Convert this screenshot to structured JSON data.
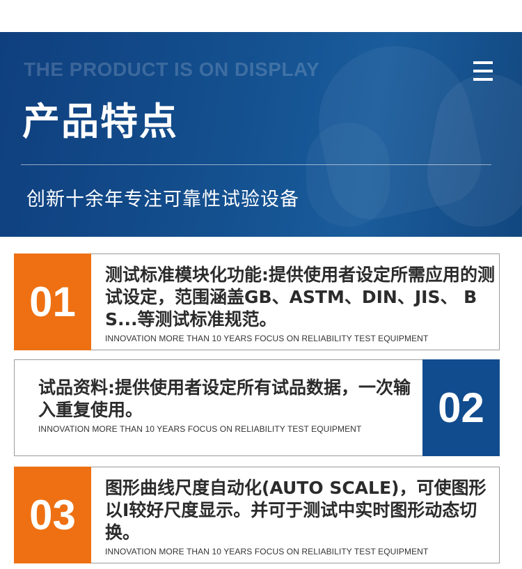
{
  "banner": {
    "subtitle_en": "THE PRODUCT IS ON DISPLAY",
    "title": "产品特点",
    "tagline": "创新十余年专注可靠性试验设备"
  },
  "features": [
    {
      "number": "01",
      "description": "测试标准模块化功能:提供使用者设定所需应用的测试设定，范围涵盖GB、ASTM、DIN、JIS、 BS...等测试标准规范。",
      "tagline_en": "INNOVATION MORE THAN 10 YEARS FOCUS ON RELIABILITY TEST EQUIPMENT",
      "accent": "#ee7012"
    },
    {
      "number": "02",
      "description": "试品资料:提供使用者设定所有试品数据，一次输入重复使用。",
      "tagline_en": "INNOVATION MORE THAN 10 YEARS FOCUS ON RELIABILITY TEST EQUIPMENT",
      "accent": "#114c8e"
    },
    {
      "number": "03",
      "description": "图形曲线尺度自动化(AUTO SCALE)，可使图形以I较好尺度显示。并可于测试中实时图形动态切换。",
      "tagline_en": "INNOVATION MORE THAN 10 YEARS FOCUS ON RELIABILITY TEST EQUIPMENT",
      "accent": "#ee7012"
    }
  ],
  "colors": {
    "banner_blue": "#14508f",
    "orange": "#ee7012",
    "blue": "#114c8e"
  },
  "icons": {
    "menu": "hamburger-menu-icon"
  }
}
